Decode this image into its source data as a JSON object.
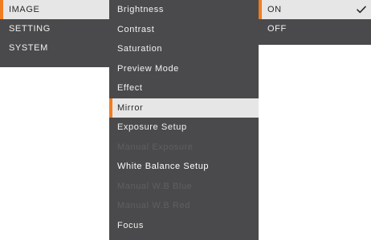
{
  "main_menu": {
    "items": [
      {
        "label": "IMAGE",
        "selected": true
      },
      {
        "label": "SETTING",
        "selected": false
      },
      {
        "label": "SYSTEM",
        "selected": false
      }
    ]
  },
  "image_menu": {
    "items": [
      {
        "label": "Brightness",
        "state": "normal"
      },
      {
        "label": "Contrast",
        "state": "normal"
      },
      {
        "label": "Saturation",
        "state": "normal"
      },
      {
        "label": "Preview Mode",
        "state": "normal"
      },
      {
        "label": "Effect",
        "state": "normal"
      },
      {
        "label": "Mirror",
        "state": "selected"
      },
      {
        "label": "Exposure Setup",
        "state": "normal"
      },
      {
        "label": "Manual Exposure",
        "state": "disabled"
      },
      {
        "label": "White Balance Setup",
        "state": "normal"
      },
      {
        "label": "Manual W.B Blue",
        "state": "disabled"
      },
      {
        "label": "Manual W.B Red",
        "state": "disabled"
      },
      {
        "label": "Focus",
        "state": "normal"
      }
    ]
  },
  "option_menu": {
    "items": [
      {
        "label": "ON",
        "selected": true,
        "checked": true
      },
      {
        "label": "OFF",
        "selected": false,
        "checked": false
      }
    ]
  },
  "colors": {
    "panel_bg": "#4a4a4c",
    "selected_bg": "#e6e6e6",
    "accent": "#f07d21",
    "text": "#f2f2f2",
    "selected_text": "#2a2a2a",
    "disabled_text": "#5f5f61"
  },
  "icons": {
    "check": "checkmark-icon"
  }
}
